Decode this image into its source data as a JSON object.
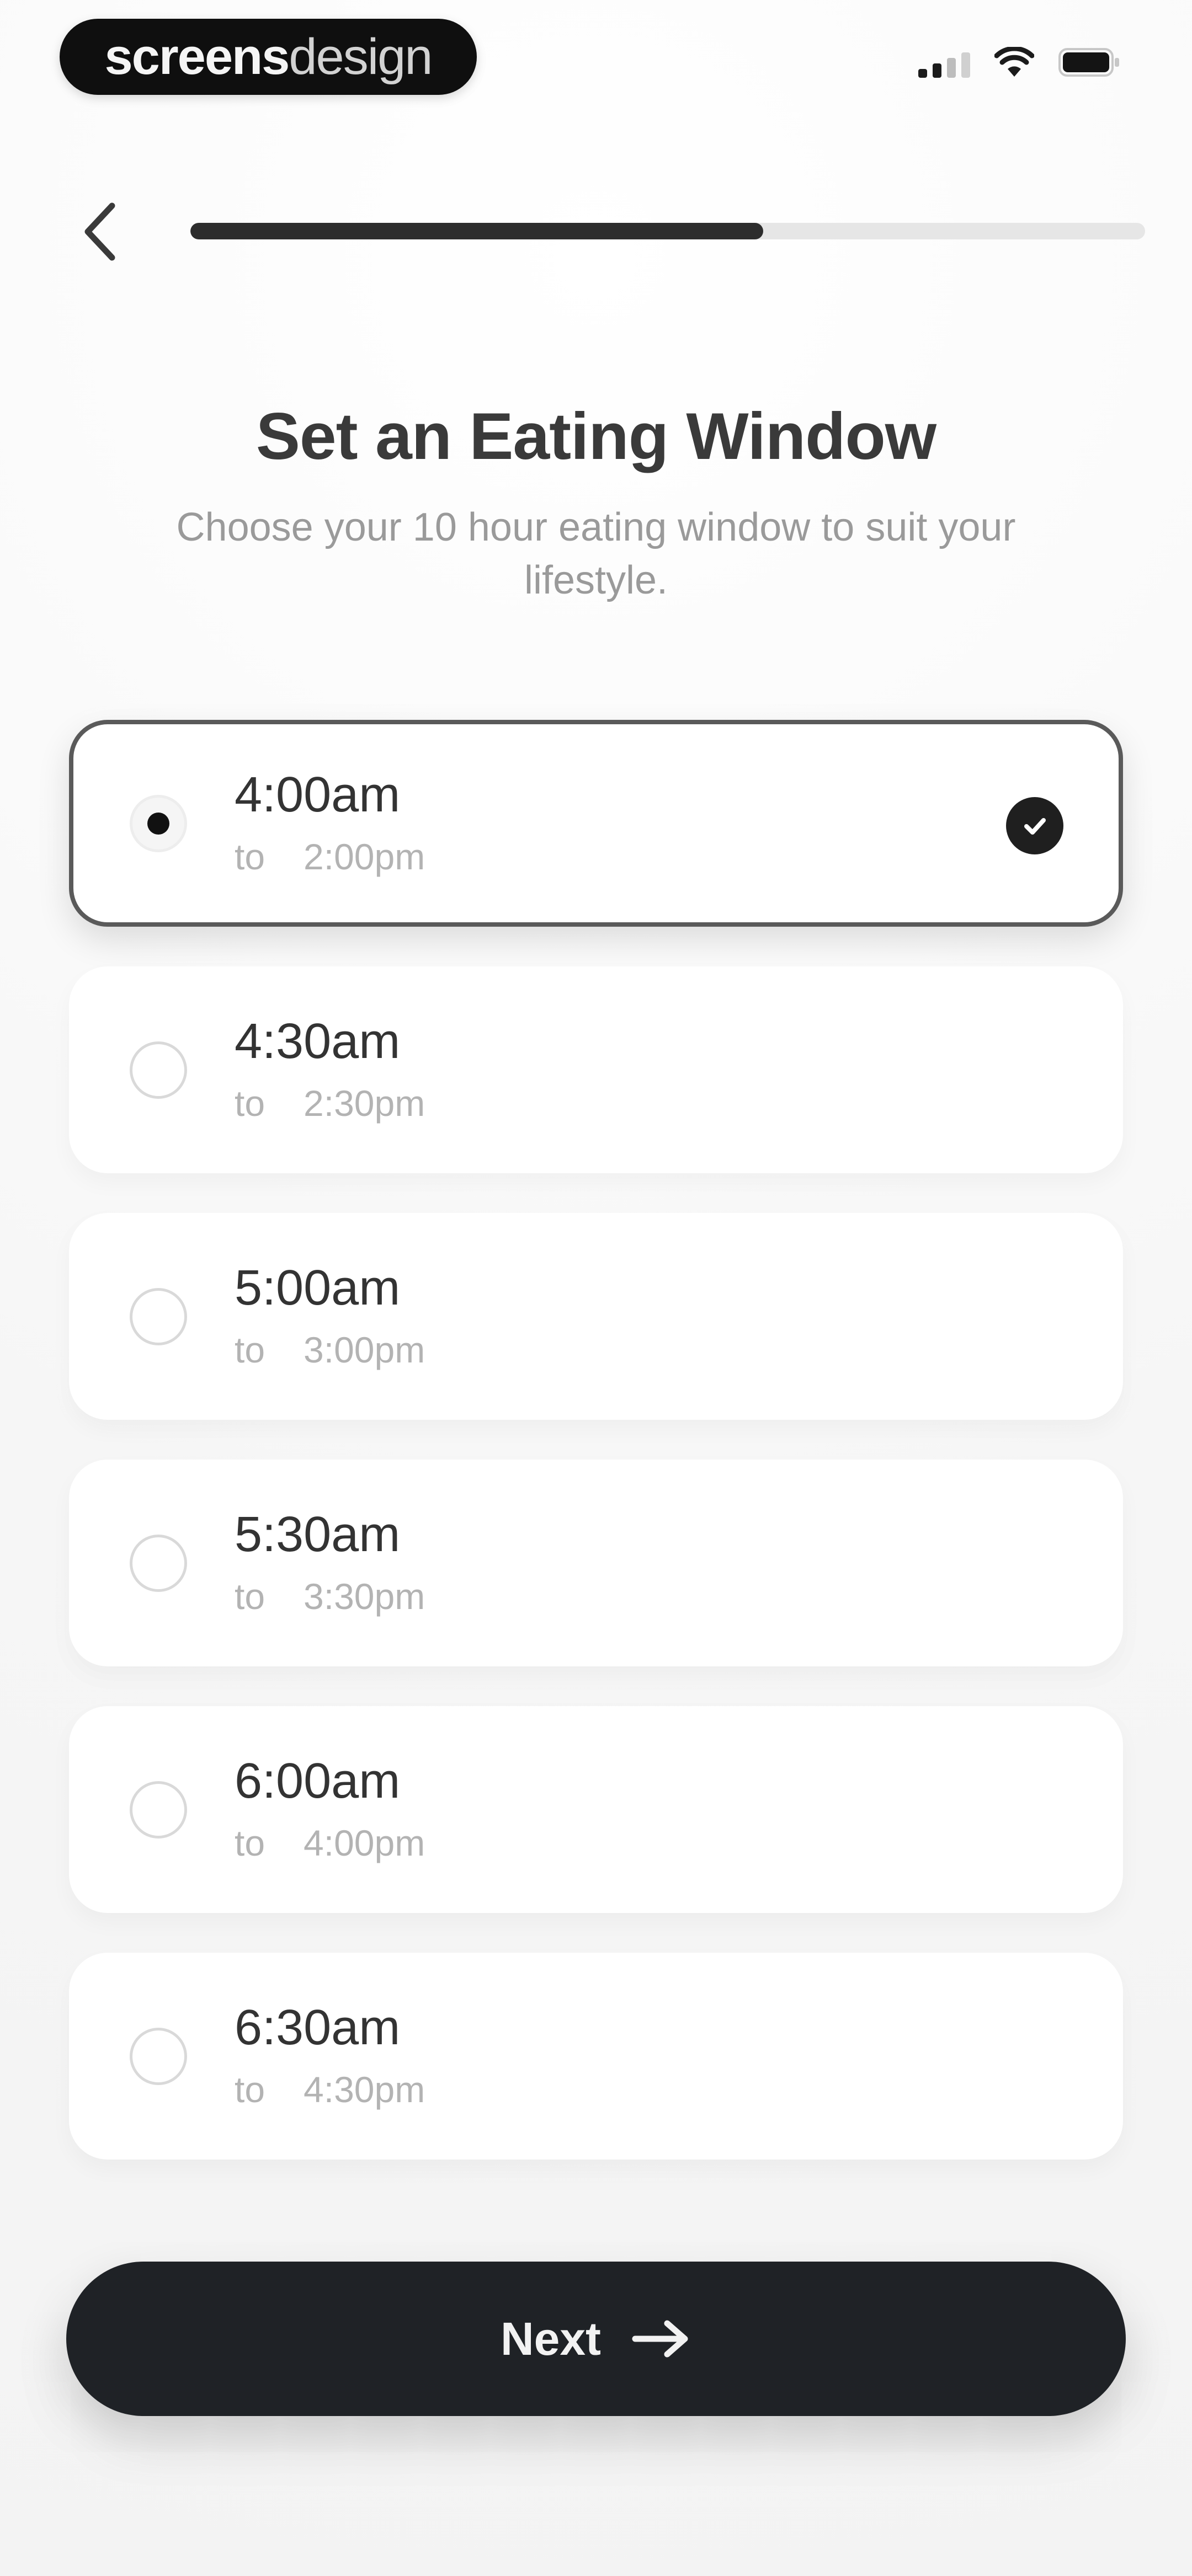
{
  "status_bar": {
    "brand_bold": "screens",
    "brand_light": "design",
    "icons": [
      "signal-icon",
      "wifi-icon",
      "battery-icon"
    ]
  },
  "header": {
    "back_icon": "chevron-left-icon",
    "progress": 0.6
  },
  "title": "Set an Eating Window",
  "subtitle": "Choose your 10 hour eating window to suit your lifestyle.",
  "options": [
    {
      "start": "4:00am",
      "to": "to",
      "end": "2:00pm",
      "selected": true
    },
    {
      "start": "4:30am",
      "to": "to",
      "end": "2:30pm",
      "selected": false
    },
    {
      "start": "5:00am",
      "to": "to",
      "end": "3:00pm",
      "selected": false
    },
    {
      "start": "5:30am",
      "to": "to",
      "end": "3:30pm",
      "selected": false
    },
    {
      "start": "6:00am",
      "to": "to",
      "end": "4:00pm",
      "selected": false
    },
    {
      "start": "6:30am",
      "to": "to",
      "end": "4:30pm",
      "selected": false
    }
  ],
  "next_button": {
    "label": "Next",
    "icon": "arrow-right-icon"
  },
  "colors": {
    "accent": "#1f2226",
    "background": "#f4f4f4",
    "card": "#ffffff",
    "muted_text": "#9a9a9a"
  }
}
